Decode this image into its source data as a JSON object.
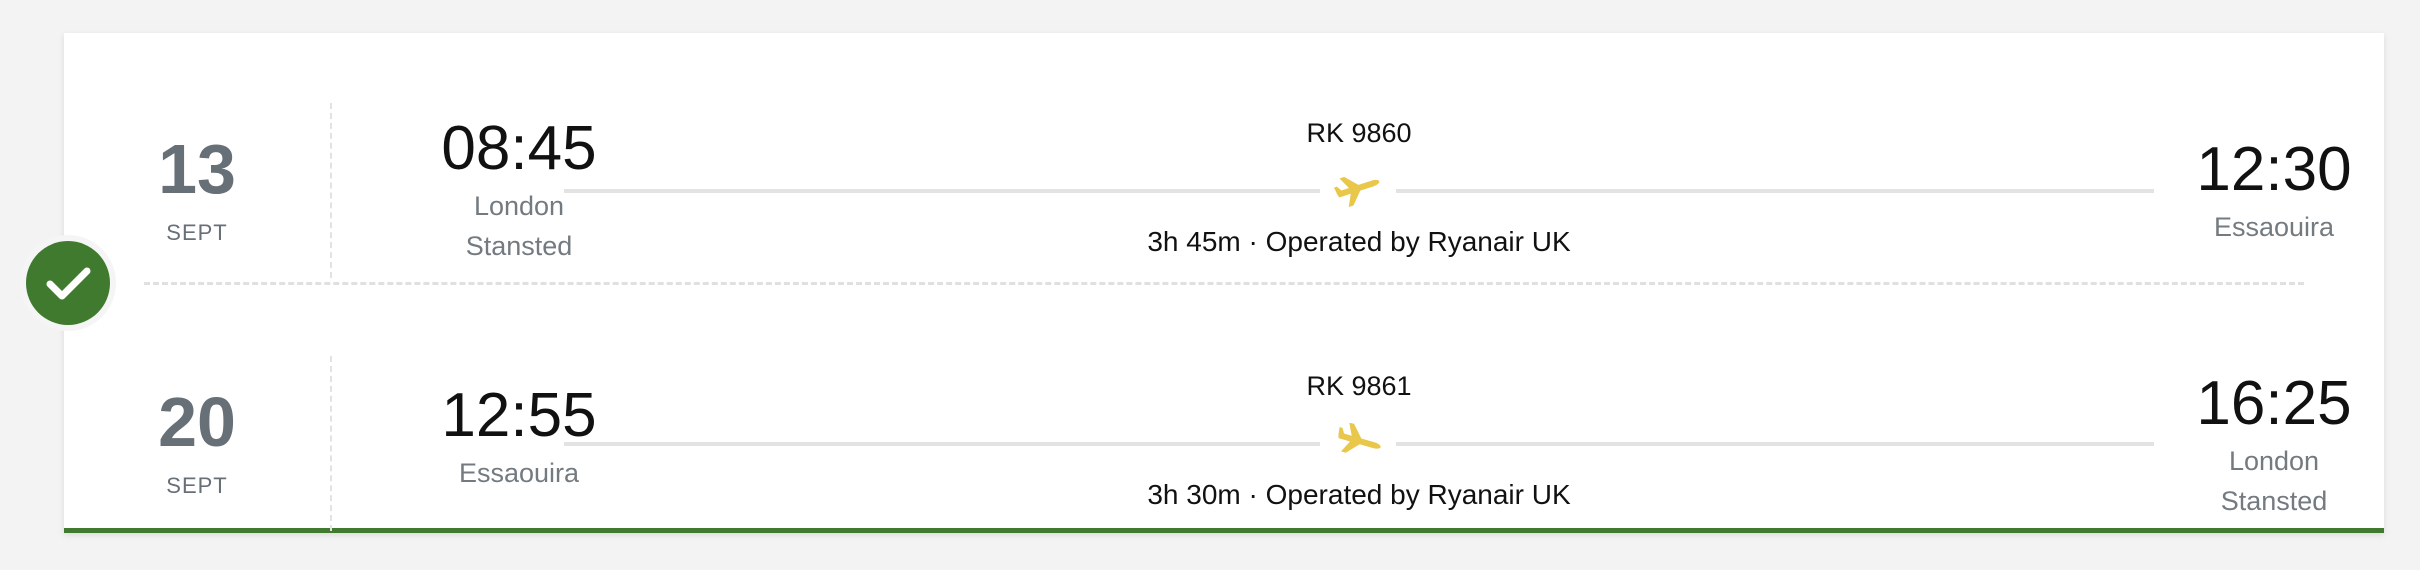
{
  "outbound": {
    "day": "13",
    "month": "SEPT",
    "departure_time": "08:45",
    "departure_place_line1": "London",
    "departure_place_line2": "Stansted",
    "flight_number": "RK 9860",
    "meta": "3h 45m · Operated by Ryanair UK",
    "arrival_time": "12:30",
    "arrival_place_line1": "Essaouira",
    "arrival_place_line2": ""
  },
  "return": {
    "day": "20",
    "month": "SEPT",
    "departure_time": "12:55",
    "departure_place_line1": "Essaouira",
    "departure_place_line2": "",
    "flight_number": "RK 9861",
    "meta": "3h 30m · Operated by Ryanair UK",
    "arrival_time": "16:25",
    "arrival_place_line1": "London",
    "arrival_place_line2": "Stansted"
  },
  "icons": {
    "selected": "check-icon",
    "outbound_plane": "plane-takeoff-icon",
    "return_plane": "plane-landing-icon"
  },
  "colors": {
    "accent_green": "#3f7a2e",
    "plane_yellow": "#e9c74a",
    "muted_text": "#676f77"
  }
}
